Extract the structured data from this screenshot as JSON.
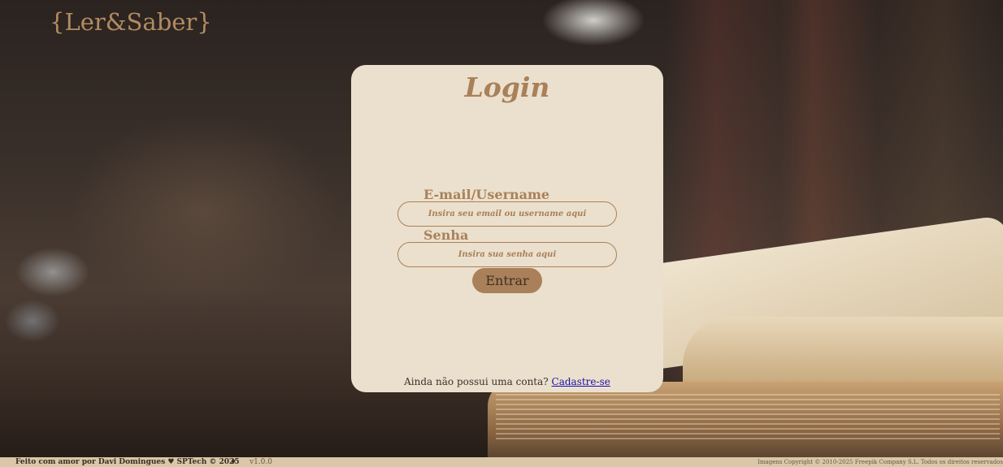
{
  "header": {
    "logo_text": "{Ler&Saber}"
  },
  "login_card": {
    "title": "Login",
    "email_label": "E-mail/Username",
    "email_placeholder": "Insira seu email ou username aqui",
    "password_label": "Senha",
    "password_placeholder": "Insira sua senha aqui",
    "submit_label": "Entrar",
    "signup_prompt": "Ainda não possui uma conta? ",
    "signup_link": "Cadastre-se"
  },
  "footer": {
    "credit": "Feito com amor por Davi Domingues ♥ SPTech © 2025",
    "separator": "♦",
    "version": "v1.0.0",
    "copyright": "Imagens Copyright © 2010-2025 Freepik Company S.L. Todos os direitos reservados"
  },
  "colors": {
    "accent": "#a98059",
    "card_background": "#ebe0cd",
    "footer_background": "#d9c7a7",
    "link": "#1a0dab"
  }
}
